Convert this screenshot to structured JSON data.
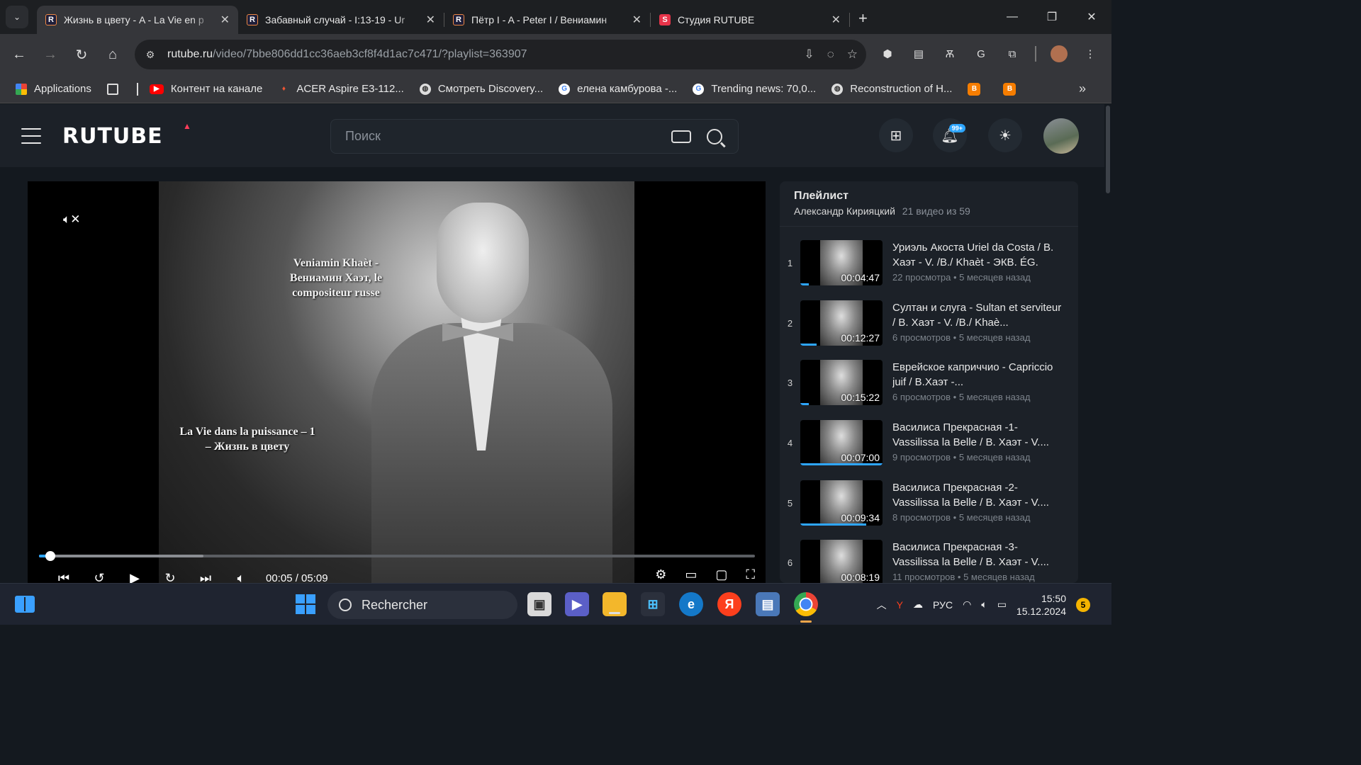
{
  "browser": {
    "tabs": [
      {
        "title": "Жизнь в цвету - A - La Vie en p",
        "icon": "rutube-icon",
        "active": true
      },
      {
        "title": "Забавный случай - I:13-19 - Ur",
        "icon": "rutube-icon",
        "active": false
      },
      {
        "title": "Пётр I - A - Peter I / Вениамин",
        "icon": "rutube-icon",
        "active": false
      },
      {
        "title": "Студия RUTUBE",
        "icon": "rutube-studio-icon",
        "active": false
      }
    ],
    "address": {
      "host": "rutube.ru",
      "path": "/video/7bbe806dd1cc36aeb3cf8f4d1ac7c471/?playlist=363907"
    },
    "bookmarks": [
      {
        "label": "Applications",
        "icon": "apps-grid-icon"
      },
      {
        "label": "Контент на канале",
        "icon": "youtube-icon"
      },
      {
        "label": "ACER Aspire E3-112...",
        "icon": "acer-icon"
      },
      {
        "label": "Смотреть Discovery...",
        "icon": "globe-icon"
      },
      {
        "label": "елена камбурова -...",
        "icon": "google-icon"
      },
      {
        "label": "Trending news: 70,0...",
        "icon": "google-icon"
      },
      {
        "label": "Reconstruction of H...",
        "icon": "globe-icon"
      }
    ]
  },
  "rutube": {
    "logo": "RUTUBE",
    "search_placeholder": "Поиск",
    "notifications_badge": "99+"
  },
  "player": {
    "subtitle_1": "Veniamin Khaèt - Вениамин Хаэт, le compositeur russe",
    "subtitle_2": "La Vie dans la puissance – 1 – Жизнь в цвету",
    "current_time": "00:05",
    "duration": "05:09",
    "time_display": "00:05 / 05:09",
    "progress_fraction": 0.016,
    "buffered_fraction": 0.23
  },
  "playlist": {
    "title": "Плейлист",
    "author": "Александр Кирияцкий",
    "count": "21 видео из 59",
    "items": [
      {
        "num": "1",
        "title": "Уриэль Акоста Uriel da Costa / В. Хаэт - V. /В./ Khaèt - ЭКВ. ÉG.",
        "duration": "00:04:47",
        "stats": "22 просмотра • 5 месяцев назад",
        "watched": 0.1
      },
      {
        "num": "2",
        "title": "Султан и слуга - Sultan et serviteur / В. Хаэт - V. /В./ Khaè...",
        "duration": "00:12:27",
        "stats": "6 просмотров • 5 месяцев назад",
        "watched": 0.2
      },
      {
        "num": "3",
        "title": "Еврейское каприччио - Capriccio juif / В.Хаэт -...",
        "duration": "00:15:22",
        "stats": "6 просмотров • 5 месяцев назад",
        "watched": 0.1
      },
      {
        "num": "4",
        "title": "Василиса Прекрасная -1- Vassilissa la Belle / В. Хаэт - V....",
        "duration": "00:07:00",
        "stats": "9 просмотров • 5 месяцев назад",
        "watched": 1.0
      },
      {
        "num": "5",
        "title": "Василиса Прекрасная -2- Vassilissa la Belle / В. Хаэт - V....",
        "duration": "00:09:34",
        "stats": "8 просмотров • 5 месяцев назад",
        "watched": 0.8
      },
      {
        "num": "6",
        "title": "Василиса Прекрасная -3- Vassilissa la Belle / В. Хаэт - V....",
        "duration": "00:08:19",
        "stats": "11 просмотров • 5 месяцев назад",
        "watched": 0.0
      }
    ]
  },
  "taskbar": {
    "search_label": "Rechercher",
    "language": "РУС",
    "time": "15:50",
    "date": "15.12.2024",
    "notification_count": "5"
  }
}
